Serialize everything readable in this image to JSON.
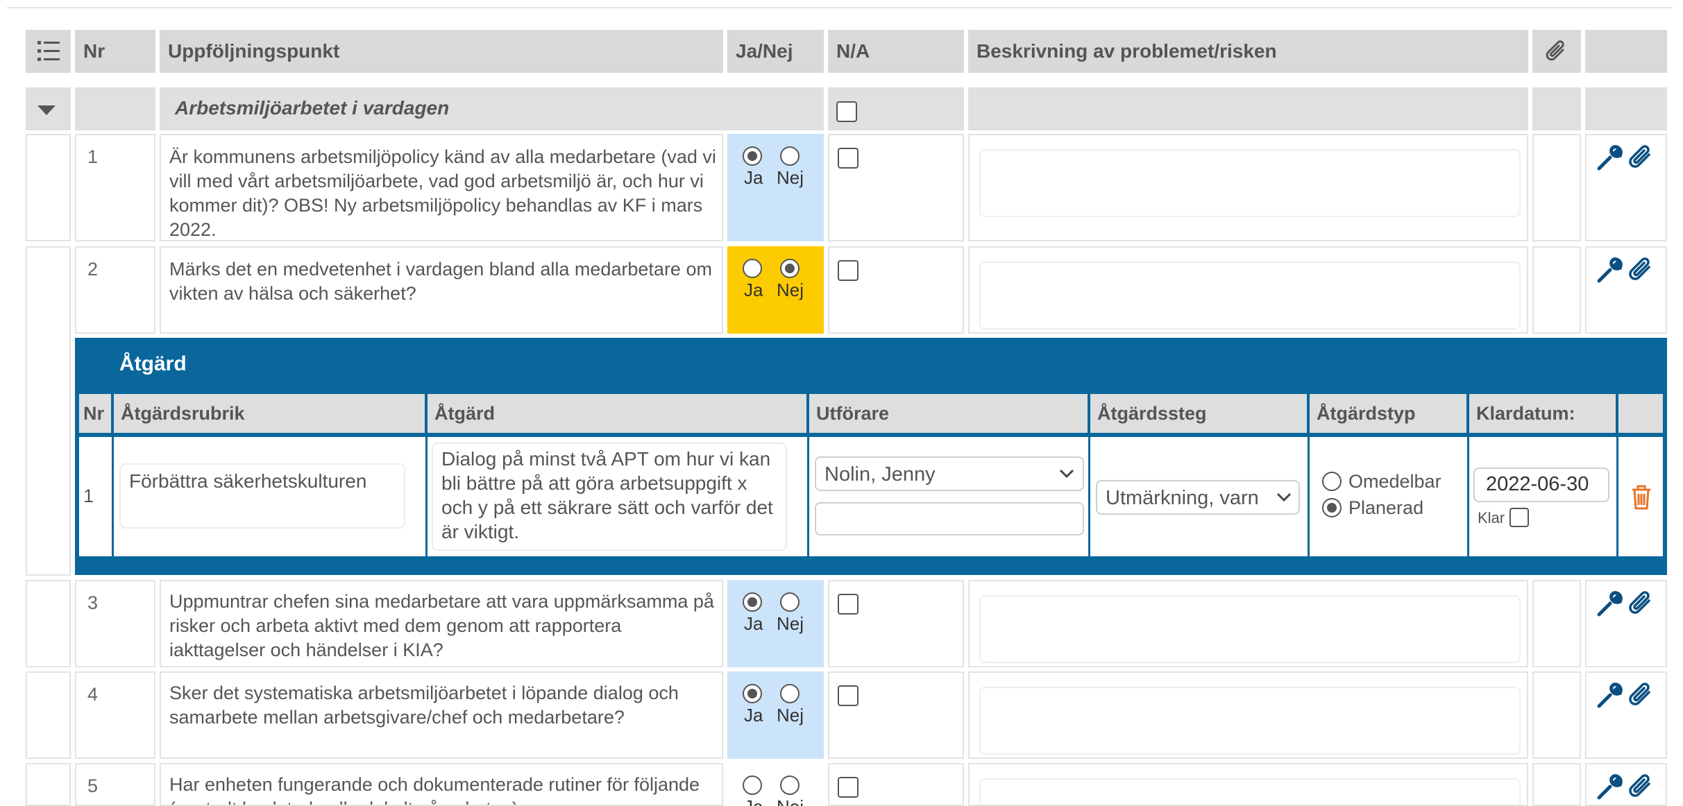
{
  "header": {
    "list_icon": "list-numbered-icon",
    "nr": "Nr",
    "point": "Uppföljningspunkt",
    "yesno": "Ja/Nej",
    "na": "N/A",
    "description": "Beskrivning av problemet/risken",
    "attach_icon": "paperclip-icon"
  },
  "group": {
    "title": "Arbetsmiljöarbetet i vardagen",
    "collapse_icon": "caret-down-icon"
  },
  "radio_labels": {
    "yes": "Ja",
    "no": "Nej"
  },
  "items": [
    {
      "nr": "1",
      "text": "Är kommunens arbetsmiljöpolicy känd av alla medarbetare (vad vi vill med vårt arbetsmiljöarbete, vad god arbetsmiljö är, och hur vi kommer dit)? OBS! Ny arbetsmiljöpolicy behandlas av KF i mars 2022.",
      "answer": "Ja"
    },
    {
      "nr": "2",
      "text": "Märks det en medvetenhet i vardagen bland alla medarbetare om vikten av hälsa och säkerhet?",
      "answer": "Nej"
    },
    {
      "nr": "3",
      "text": "Uppmuntrar chefen sina medarbetare att vara uppmärksamma på risker och arbeta aktivt med dem genom att rapportera iakttagelser och händelser i KIA?",
      "answer": "Ja"
    },
    {
      "nr": "4",
      "text": "Sker det systematiska arbetsmiljöarbetet i löpande dialog och samarbete mellan arbetsgivare/chef och medarbetare?",
      "answer": "Ja"
    },
    {
      "nr": "5",
      "text": "Har enheten fungerande och dokumenterade rutiner för följande (centralt beslutade eller lokalt på enheten):",
      "answer": ""
    }
  ],
  "action": {
    "title": "Åtgärd",
    "columns": {
      "nr": "Nr",
      "heading": "Åtgärdsrubrik",
      "action": "Åtgärd",
      "performer": "Utförare",
      "step": "Åtgärdssteg",
      "type": "Åtgärdstyp",
      "date": "Klardatum:"
    },
    "row": {
      "nr": "1",
      "heading": "Förbättra säkerhetskulturen",
      "action": "Dialog på minst två APT om hur vi kan bli bättre på att göra arbetsuppgift x och y på ett säkrare sätt och varför det är viktigt.",
      "performer": "Nolin, Jenny",
      "step": "Utmärkning, varn",
      "type_options": [
        "Omedelbar",
        "Planerad"
      ],
      "type_selected": "Planerad",
      "date": "2022-06-30",
      "done_label": "Klar",
      "delete_icon": "trash-icon"
    }
  },
  "colors": {
    "header_bg": "#d9d9d9",
    "yes_bg": "#cce4fa",
    "no_bg": "#fdcc00",
    "action_blue": "#09679c"
  }
}
